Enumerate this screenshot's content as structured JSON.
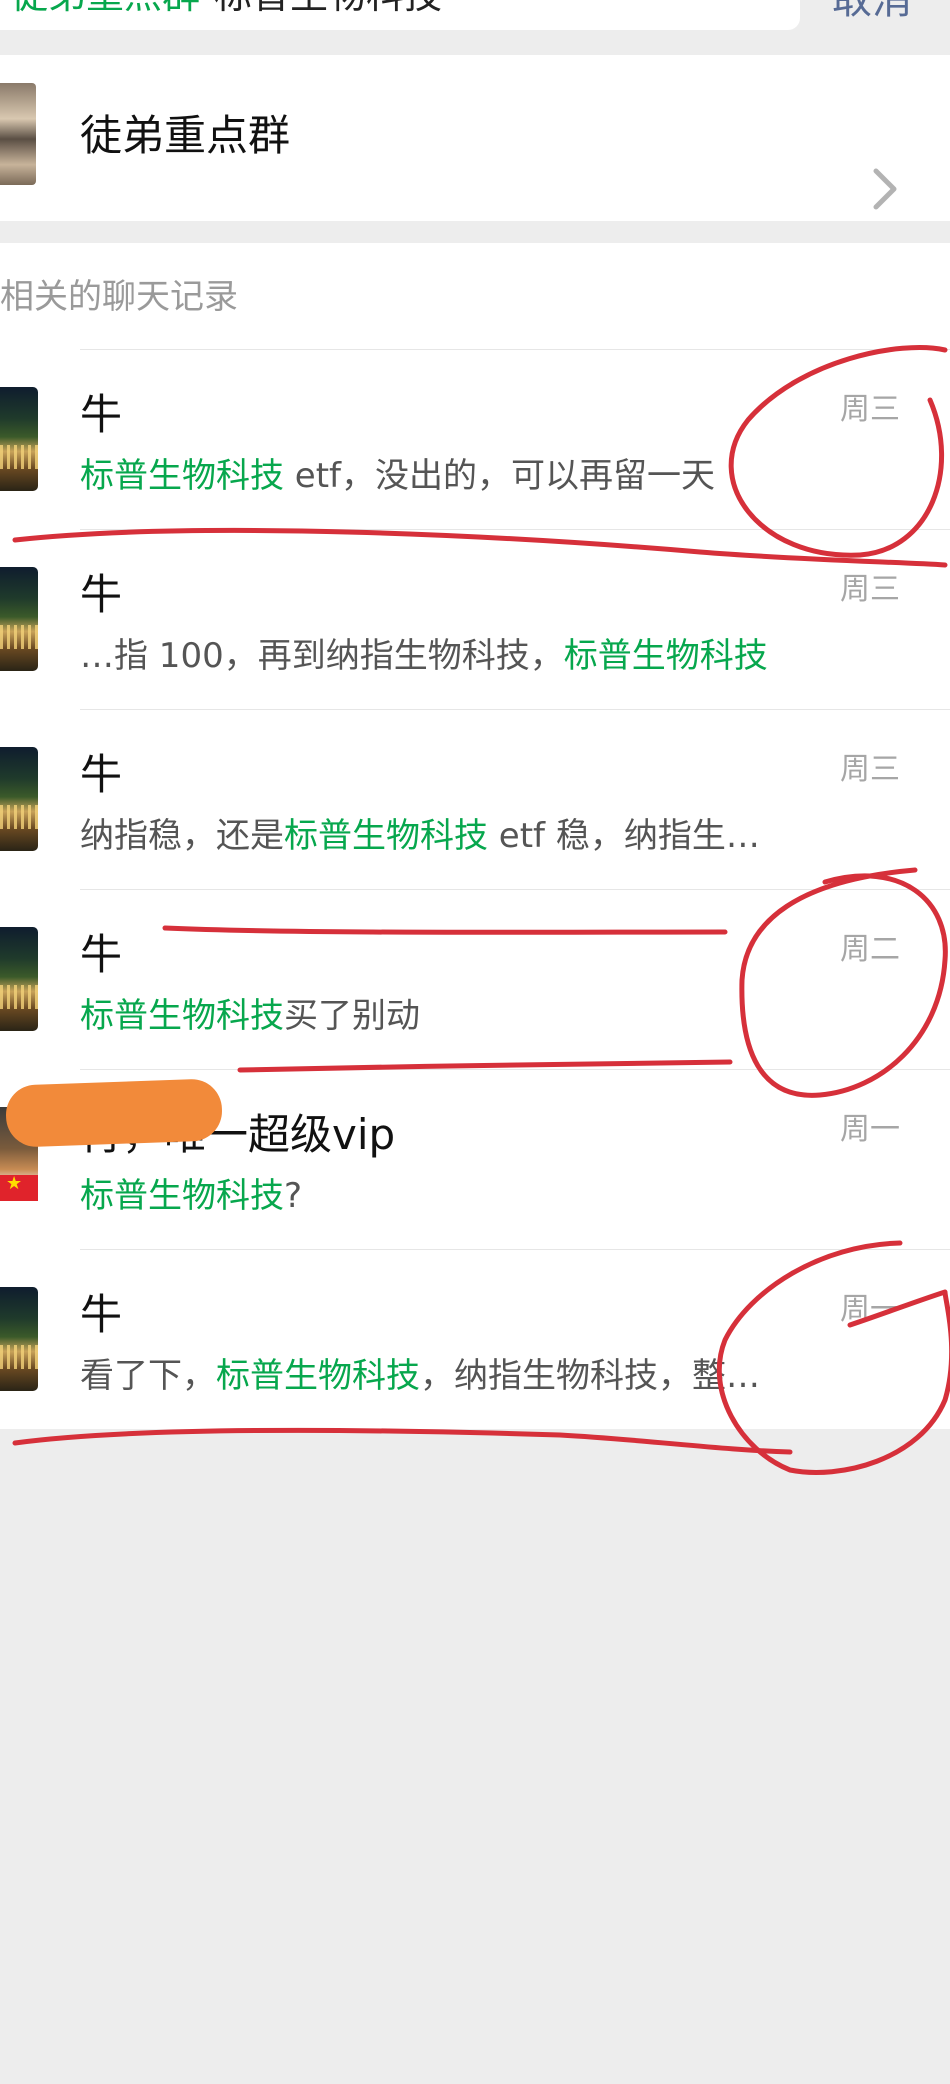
{
  "search": {
    "scope": "徒弟重点群",
    "query": "标普生物科技",
    "cancel_label": "取消"
  },
  "group": {
    "name": "徒弟重点群",
    "icon": "chevron-right-icon"
  },
  "section_title": "相关的聊天记录",
  "highlight_color": "#07a74d",
  "results": [
    {
      "sender": "牛",
      "time": "周三",
      "pre": "",
      "highlight": "标普生物科技",
      "post": " etf，没出的，可以再留一天"
    },
    {
      "sender": "牛",
      "time": "周三",
      "pre": "…指 100，再到纳指生物科技，",
      "highlight": "标普生物科技",
      "post": ""
    },
    {
      "sender": "牛",
      "time": "周三",
      "pre": "纳指稳，还是",
      "highlight": "标普生物科技",
      "post": " etf 稳，纳指生…"
    },
    {
      "sender": "牛",
      "time": "周二",
      "pre": "",
      "highlight": "标普生物科技",
      "post": "买了别动"
    },
    {
      "sender": "肖，唯一超级vip",
      "time": "周一",
      "pre": "",
      "highlight": "标普生物科技",
      "post": "?"
    },
    {
      "sender": "牛",
      "time": "周一",
      "pre": "看了下，",
      "highlight": "标普生物科技",
      "post": "，纳指生物科技，整…"
    }
  ]
}
